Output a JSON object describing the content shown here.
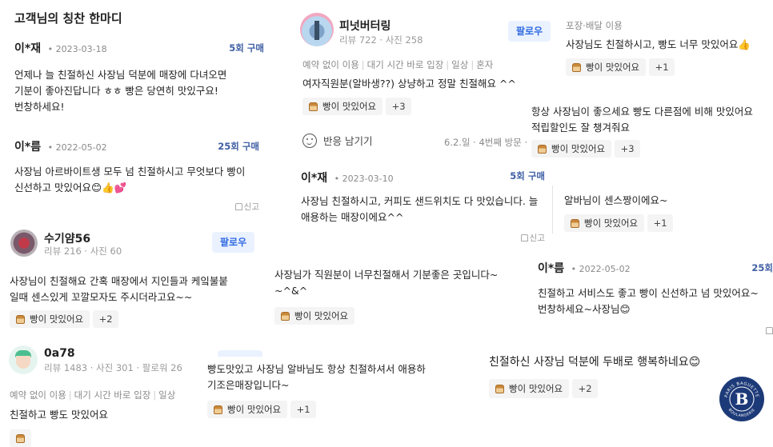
{
  "header": {
    "title": "고객님의 칭찬 한마디"
  },
  "common": {
    "bread_chip": "빵이 맛있어요",
    "report": "신고",
    "follow": "팔로우"
  },
  "r1": {
    "name": "이*재",
    "date": "2023-03-18",
    "visits": "5회 구매",
    "line1": "언제나 늘 친절하신 사장님 덕분에 매장에 다녀오면",
    "line2": "기분이 좋아진답니다 ㅎㅎ 빵은 당연히 맛있구요!",
    "line3": "번창하세요!"
  },
  "r2": {
    "name": "이*름",
    "date": "2022-05-02",
    "visits": "25회 구매",
    "line1": "사장님 아르바이트생 모두 넘 친절하시고 무엇보다 빵이",
    "line2": "신선하고 맛있어요😊👍💕"
  },
  "r3": {
    "name": "수기얌56",
    "stats": "리뷰 216 · 사진 60",
    "line1": "사장님이 친절해요 간혹 매장에서 지인들과 케잌불붙",
    "line2": "일때 센스있게 꼬깔모자도 주시더라고요~~",
    "plus": "+2"
  },
  "r4": {
    "name": "0a78",
    "stats": "리뷰 1483 · 사진 301 · 팔로워 26",
    "tags": [
      "예약 없이 이용",
      "대기 시간 바로 입장",
      "일상"
    ],
    "body": "친절하고 빵도 맛있어요"
  },
  "r5": {
    "name": "피넛버터링",
    "stats": "리뷰 722 · 사진 258",
    "tags": [
      "예약 없이 이용",
      "대기 시간 바로 입장",
      "일상",
      "혼자"
    ],
    "body": "여자직원분(알바생??) 상냥하고 정말 친절해요 ^^",
    "plus": "+3",
    "react": "반응 남기기",
    "visit_info": "6.2.일 · 4번째 방문 ·"
  },
  "r6": {
    "name": "이*재",
    "date": "2023-03-10",
    "visits": "5회 구매",
    "line1": "사장님 친절하시고, 커피도 샌드위치도 다 맛있습니다. 늘",
    "line2": "애용하는 매장이에요^^"
  },
  "r7": {
    "line1": "사장님가 직원분이 너무친절해서 기분좋은 곳입니다~",
    "line2": "~^&^"
  },
  "r8": {
    "line1": "빵도맛있고 사장님 알바님도 항상 친절하셔서 애용하",
    "line2": "기조은매장입니다~",
    "plus": "+1"
  },
  "r9": {
    "tag": "포장·배달 이용",
    "body": "사장님도 친절하시고, 빵도 너무 맛있어요👍",
    "plus": "+1"
  },
  "r10": {
    "line1": "항상 사장님이 좋으세요 빵도 다른점에 비해 맛있어요",
    "line2": "적립할인도 잘 챙겨줘요",
    "plus": "+3"
  },
  "r11": {
    "body": "알바님이 센스짱이에요~",
    "plus": "+1"
  },
  "r12": {
    "name": "이*름",
    "date": "2022-05-02",
    "visits": "25회",
    "line1": "친절하고 서비스도 좋고 빵이 신선하고 넘 맛있어요~",
    "line2": "번창하세요~사장님😊"
  },
  "r13": {
    "body": "친절하신 사장님 덕분에 두배로 행복하네요😊",
    "plus": "+2"
  },
  "logo": {
    "ring_top": "PARIS BAGUETTE",
    "ring_bottom": "BOULANGERIE",
    "letter": "B",
    "color": "#1d3a78"
  },
  "colors": {
    "accent": "#3f5fa3",
    "follow_bg": "#eaf2ff",
    "follow_fg": "#2f6ae0"
  }
}
